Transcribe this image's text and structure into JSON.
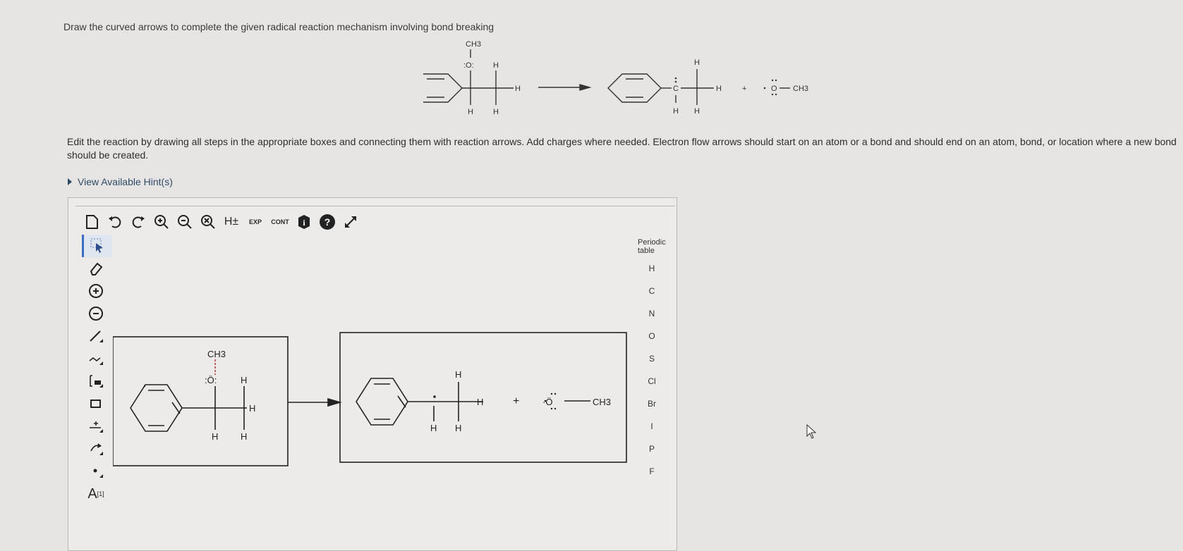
{
  "question": {
    "prompt": "Draw the curved arrows to complete the given radical reaction mechanism involving bond breaking",
    "instructions": "Edit the reaction by drawing all steps in the appropriate boxes and connecting them with reaction arrows. Add charges where needed. Electron flow arrows should start on an atom or a bond and should end on an atom, bond, or location where a new bond should be created.",
    "hint_link": "View Available Hint(s)"
  },
  "reaction_reference": {
    "reactant_labels": [
      "CH3",
      ":O:",
      "H",
      "H",
      "H",
      "H"
    ],
    "product_labels": [
      "H",
      "C",
      "H",
      "H",
      "H",
      "+",
      "O",
      "CH3"
    ]
  },
  "toolbar": {
    "h_toggle": "H±",
    "exp": "EXP",
    "cont": "CONT"
  },
  "left_tools": {
    "text_tool": "A",
    "text_tool_sup": "[1]"
  },
  "canvas": {
    "box1_labels": {
      "ch3": "CH3",
      "oxygen": ":Ö:",
      "h_top": "H",
      "h_right": "H",
      "h_bottom1": "H",
      "h_bottom2": "H"
    },
    "box2_labels": {
      "h_top": "H",
      "h_right": "H",
      "h_bottom1": "H",
      "h_bottom2": "H",
      "plus": "+",
      "oxygen": "·Ö",
      "ch3": "CH3"
    }
  },
  "palette": {
    "periodic_label": "Periodic table",
    "elements": [
      "H",
      "C",
      "N",
      "O",
      "S",
      "Cl",
      "Br",
      "I",
      "P",
      "F"
    ]
  },
  "colors": {
    "link": "#2e4a66",
    "selected_tool": "#3a6fc4",
    "background": "#e6e5e3"
  }
}
